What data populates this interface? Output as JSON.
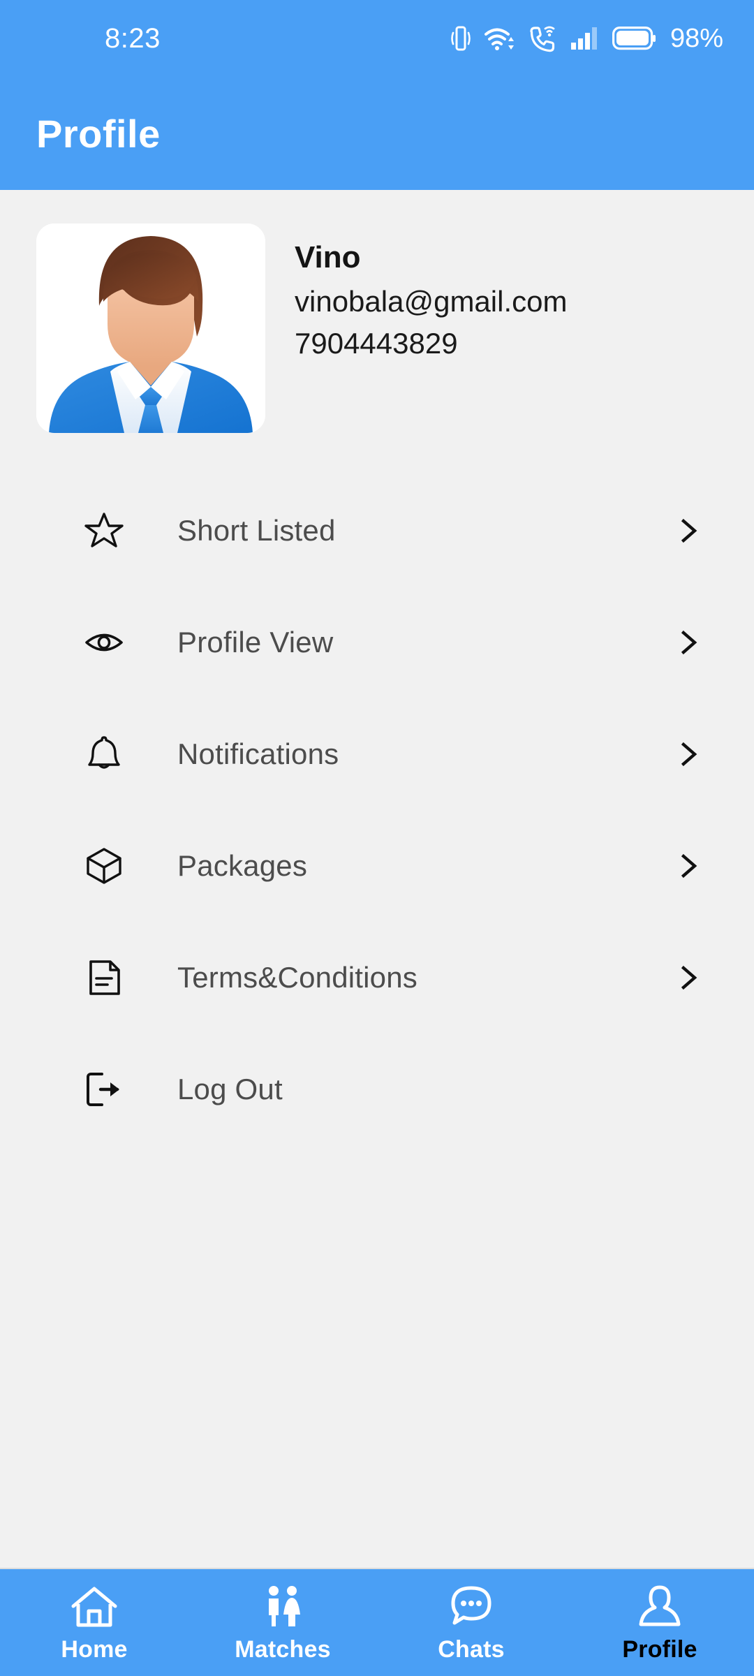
{
  "status_bar": {
    "time": "8:23",
    "battery_percent": "98%",
    "icons": [
      "vibrate-icon",
      "wifi-icon",
      "vowifi-call-icon",
      "signal-bars-icon",
      "battery-icon"
    ]
  },
  "header": {
    "title": "Profile"
  },
  "profile": {
    "avatar_icon": "user-avatar-illustration",
    "name": "Vino",
    "email": "vinobala@gmail.com",
    "phone": "7904443829"
  },
  "menu": {
    "items": [
      {
        "label": "Short Listed",
        "icon": "star-icon",
        "chevron": true
      },
      {
        "label": "Profile View",
        "icon": "eye-icon",
        "chevron": true
      },
      {
        "label": "Notifications",
        "icon": "bell-icon",
        "chevron": true
      },
      {
        "label": "Packages",
        "icon": "box-icon",
        "chevron": true
      },
      {
        "label": "Terms&Conditions",
        "icon": "document-icon",
        "chevron": true
      },
      {
        "label": "Log Out",
        "icon": "logout-icon",
        "chevron": false
      }
    ]
  },
  "bottom_nav": {
    "items": [
      {
        "label": "Home",
        "icon": "home-icon",
        "active": false
      },
      {
        "label": "Matches",
        "icon": "couple-icon",
        "active": false
      },
      {
        "label": "Chats",
        "icon": "chat-icon",
        "active": false
      },
      {
        "label": "Profile",
        "icon": "person-icon",
        "active": true
      }
    ]
  },
  "colors": {
    "accent_blue": "#4a9ff5",
    "background_gray": "#f1f1f1",
    "menu_text": "#4c4c4c",
    "active_nav_label": "#000000"
  }
}
